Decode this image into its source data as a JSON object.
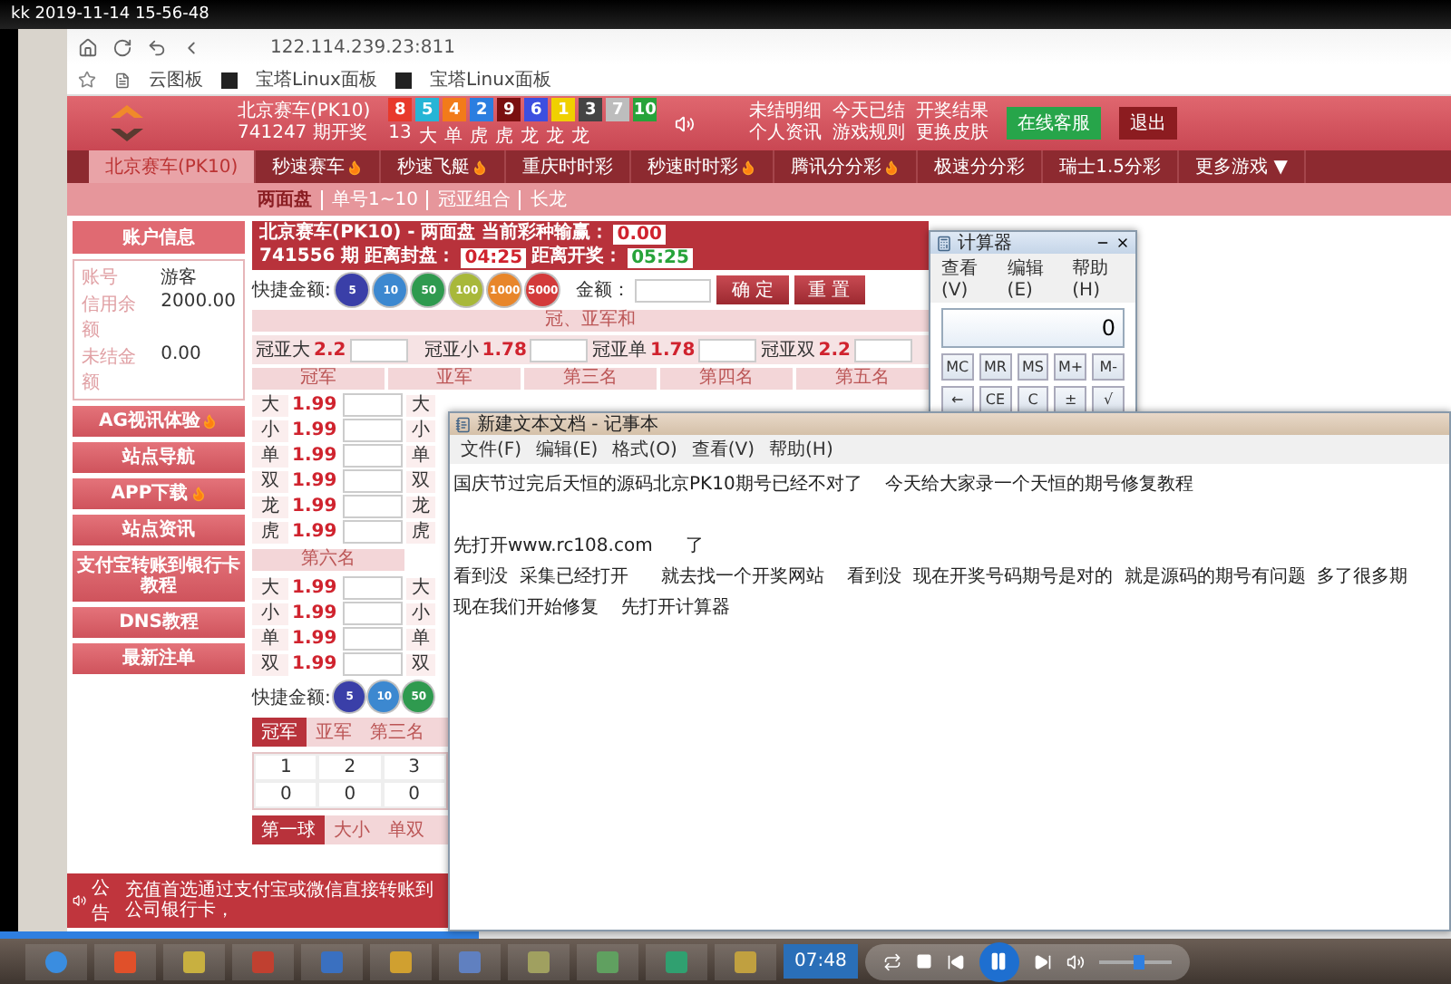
{
  "recorder": {
    "title": "kk 2019-11-14 15-56-48"
  },
  "browser": {
    "url": "122.114.239.23:811",
    "bookmarks": [
      {
        "kind": "doc",
        "label": "云图板"
      },
      {
        "kind": "bt",
        "label": "宝塔Linux面板"
      },
      {
        "kind": "bt",
        "label": "宝塔Linux面板"
      }
    ]
  },
  "header": {
    "lottery_name": "北京赛车(PK10)",
    "period": "741247 期开奖",
    "balls": [
      {
        "number": "8",
        "color": "#e8392b"
      },
      {
        "number": "5",
        "color": "#26b5d6"
      },
      {
        "number": "4",
        "color": "#f27b1a"
      },
      {
        "number": "2",
        "color": "#2b7ee0"
      },
      {
        "number": "9",
        "color": "#7a1010"
      },
      {
        "number": "6",
        "color": "#3d4fe0"
      },
      {
        "number": "1",
        "color": "#f0d000"
      },
      {
        "number": "3",
        "color": "#444444"
      },
      {
        "number": "7",
        "color": "#bdbdbd"
      },
      {
        "number": "10",
        "color": "#27a33a"
      }
    ],
    "ball_labels": [
      "13",
      "大",
      "单",
      "虎",
      "虎",
      "龙",
      "龙",
      "龙"
    ],
    "links": [
      "未结明细",
      "今天已结",
      "开奖结果",
      "个人资讯",
      "游戏规则",
      "更换皮肤"
    ],
    "buttons": [
      {
        "kind": "service",
        "label": "在线客服"
      },
      {
        "kind": "logout",
        "label": "退出"
      }
    ]
  },
  "nav": [
    {
      "label": "北京赛车(PK10)",
      "selected": true,
      "hot": false
    },
    {
      "label": "秒速赛车",
      "selected": false,
      "hot": true
    },
    {
      "label": "秒速飞艇",
      "selected": false,
      "hot": true
    },
    {
      "label": "重庆时时彩",
      "selected": false,
      "hot": false
    },
    {
      "label": "秒速时时彩",
      "selected": false,
      "hot": true
    },
    {
      "label": "腾讯分分彩",
      "selected": false,
      "hot": true
    },
    {
      "label": "极速分分彩",
      "selected": false,
      "hot": false
    },
    {
      "label": "瑞士1.5分彩",
      "selected": false,
      "hot": false
    },
    {
      "label": "更多游戏 ▼",
      "selected": false,
      "hot": false
    }
  ],
  "subnav": [
    {
      "label": "两面盘",
      "selected": true
    },
    {
      "label": "单号1~10",
      "selected": false
    },
    {
      "label": "冠亚组合",
      "selected": false
    },
    {
      "label": "长龙",
      "selected": false
    }
  ],
  "account": {
    "title": "账户信息",
    "fields": [
      {
        "label": "账号",
        "value": "游客"
      },
      {
        "label": "信用余额",
        "value": "2000.00"
      },
      {
        "label": "未结金额",
        "value": "0.00"
      }
    ]
  },
  "sidebar_links": [
    {
      "label": "AG视讯体验",
      "hot": true
    },
    {
      "label": "站点导航",
      "hot": false
    },
    {
      "label": "APP下载",
      "hot": true
    },
    {
      "label": "站点资讯",
      "hot": false
    },
    {
      "label": "支付宝转账到银行卡教程",
      "hot": false
    },
    {
      "label": "DNS教程",
      "hot": false
    },
    {
      "label": "最新注单",
      "hot": false
    }
  ],
  "game": {
    "title": "北京赛车(PK10) - 两面盘",
    "profit_label": "当前彩种输赢：",
    "profit": "0.00",
    "period": "741556 期",
    "close_label": "距离封盘：",
    "close_time": "04:25",
    "draw_label": "距离开奖：",
    "draw_time": "05:25"
  },
  "quick_amount": {
    "label": "快捷金额:",
    "chips": [
      {
        "value": "5",
        "color": "#3a3fa8"
      },
      {
        "value": "10",
        "color": "#3c88d0"
      },
      {
        "value": "50",
        "color": "#2f9a4f"
      },
      {
        "value": "100",
        "color": "#a8b83a"
      },
      {
        "value": "1000",
        "color": "#e8862a"
      },
      {
        "value": "5000",
        "color": "#d33a3a"
      }
    ],
    "amount_label": "金额：",
    "buttons": [
      "确 定",
      "重 置"
    ]
  },
  "sum_section": {
    "title": "冠、亚军和",
    "items": [
      {
        "label": "冠亚大",
        "odds": "2.2"
      },
      {
        "label": "冠亚小",
        "odds": "1.78"
      },
      {
        "label": "冠亚单",
        "odds": "1.78"
      },
      {
        "label": "冠亚双",
        "odds": "2.2"
      }
    ]
  },
  "positions": [
    "冠军",
    "亚军",
    "第三名",
    "第四名",
    "第五名"
  ],
  "champion_rows": [
    {
      "label": "大",
      "odds": "1.99"
    },
    {
      "label": "小",
      "odds": "1.99"
    },
    {
      "label": "单",
      "odds": "1.99"
    },
    {
      "label": "双",
      "odds": "1.99"
    },
    {
      "label": "龙",
      "odds": "1.99"
    },
    {
      "label": "虎",
      "odds": "1.99"
    }
  ],
  "runner_labels": [
    "大",
    "小",
    "单",
    "双",
    "龙",
    "虎"
  ],
  "sixth": {
    "title": "第六名",
    "rows": [
      {
        "label": "大",
        "odds": "1.99"
      },
      {
        "label": "小",
        "odds": "1.99"
      },
      {
        "label": "单",
        "odds": "1.99"
      },
      {
        "label": "双",
        "odds": "1.99"
      }
    ],
    "next_labels": [
      "大",
      "小",
      "单",
      "双"
    ]
  },
  "quick_amount_2": {
    "label": "快捷金额:",
    "chips": [
      {
        "value": "5",
        "color": "#3a3fa8"
      },
      {
        "value": "10",
        "color": "#3c88d0"
      },
      {
        "value": "50",
        "color": "#2f9a4f"
      }
    ]
  },
  "result_tabs": [
    {
      "label": "冠军",
      "selected": true
    },
    {
      "label": "亚军",
      "selected": false
    },
    {
      "label": "第三名",
      "selected": false
    }
  ],
  "result_table": {
    "columns": [
      "1",
      "2",
      "3"
    ],
    "values": [
      "0",
      "0",
      "0"
    ]
  },
  "ball_tabs": [
    {
      "label": "第一球",
      "selected": true
    },
    {
      "label": "大小",
      "selected": false
    },
    {
      "label": "单双",
      "selected": false
    }
  ],
  "notice": {
    "label": "公告",
    "text": "充值首选通过支付宝或微信直接转账到公司银行卡，"
  },
  "calculator": {
    "title": "计算器",
    "menu": [
      "查看(V)",
      "编辑(E)",
      "帮助(H)"
    ],
    "display": "0",
    "keys": [
      "MC",
      "MR",
      "MS",
      "M+",
      "M-",
      "←",
      "CE",
      "C",
      "±",
      "√"
    ]
  },
  "notepad": {
    "title": "新建文本文档 - 记事本",
    "menu": [
      "文件(F)",
      "编辑(E)",
      "格式(O)",
      "查看(V)",
      "帮助(H)"
    ],
    "lines": [
      [
        "国庆节过完后天恒的源码北京PK10期号已经不对了    今天给大家录一个天恒的期号修复教程"
      ],
      [
        "先打开www.rc108.com",
        "了"
      ],
      [
        "看到没  采集已经打开",
        "就去找一个开奖网站    看到没  现在开奖号码期号是对的  就是源码的期号有问题  多了很多期"
      ],
      [
        "现在我们开始修复    先打开计算器"
      ]
    ]
  },
  "player": {
    "time": "07:48",
    "progress": {
      "level": 0.33
    },
    "volume": {
      "level": 0.55
    }
  }
}
